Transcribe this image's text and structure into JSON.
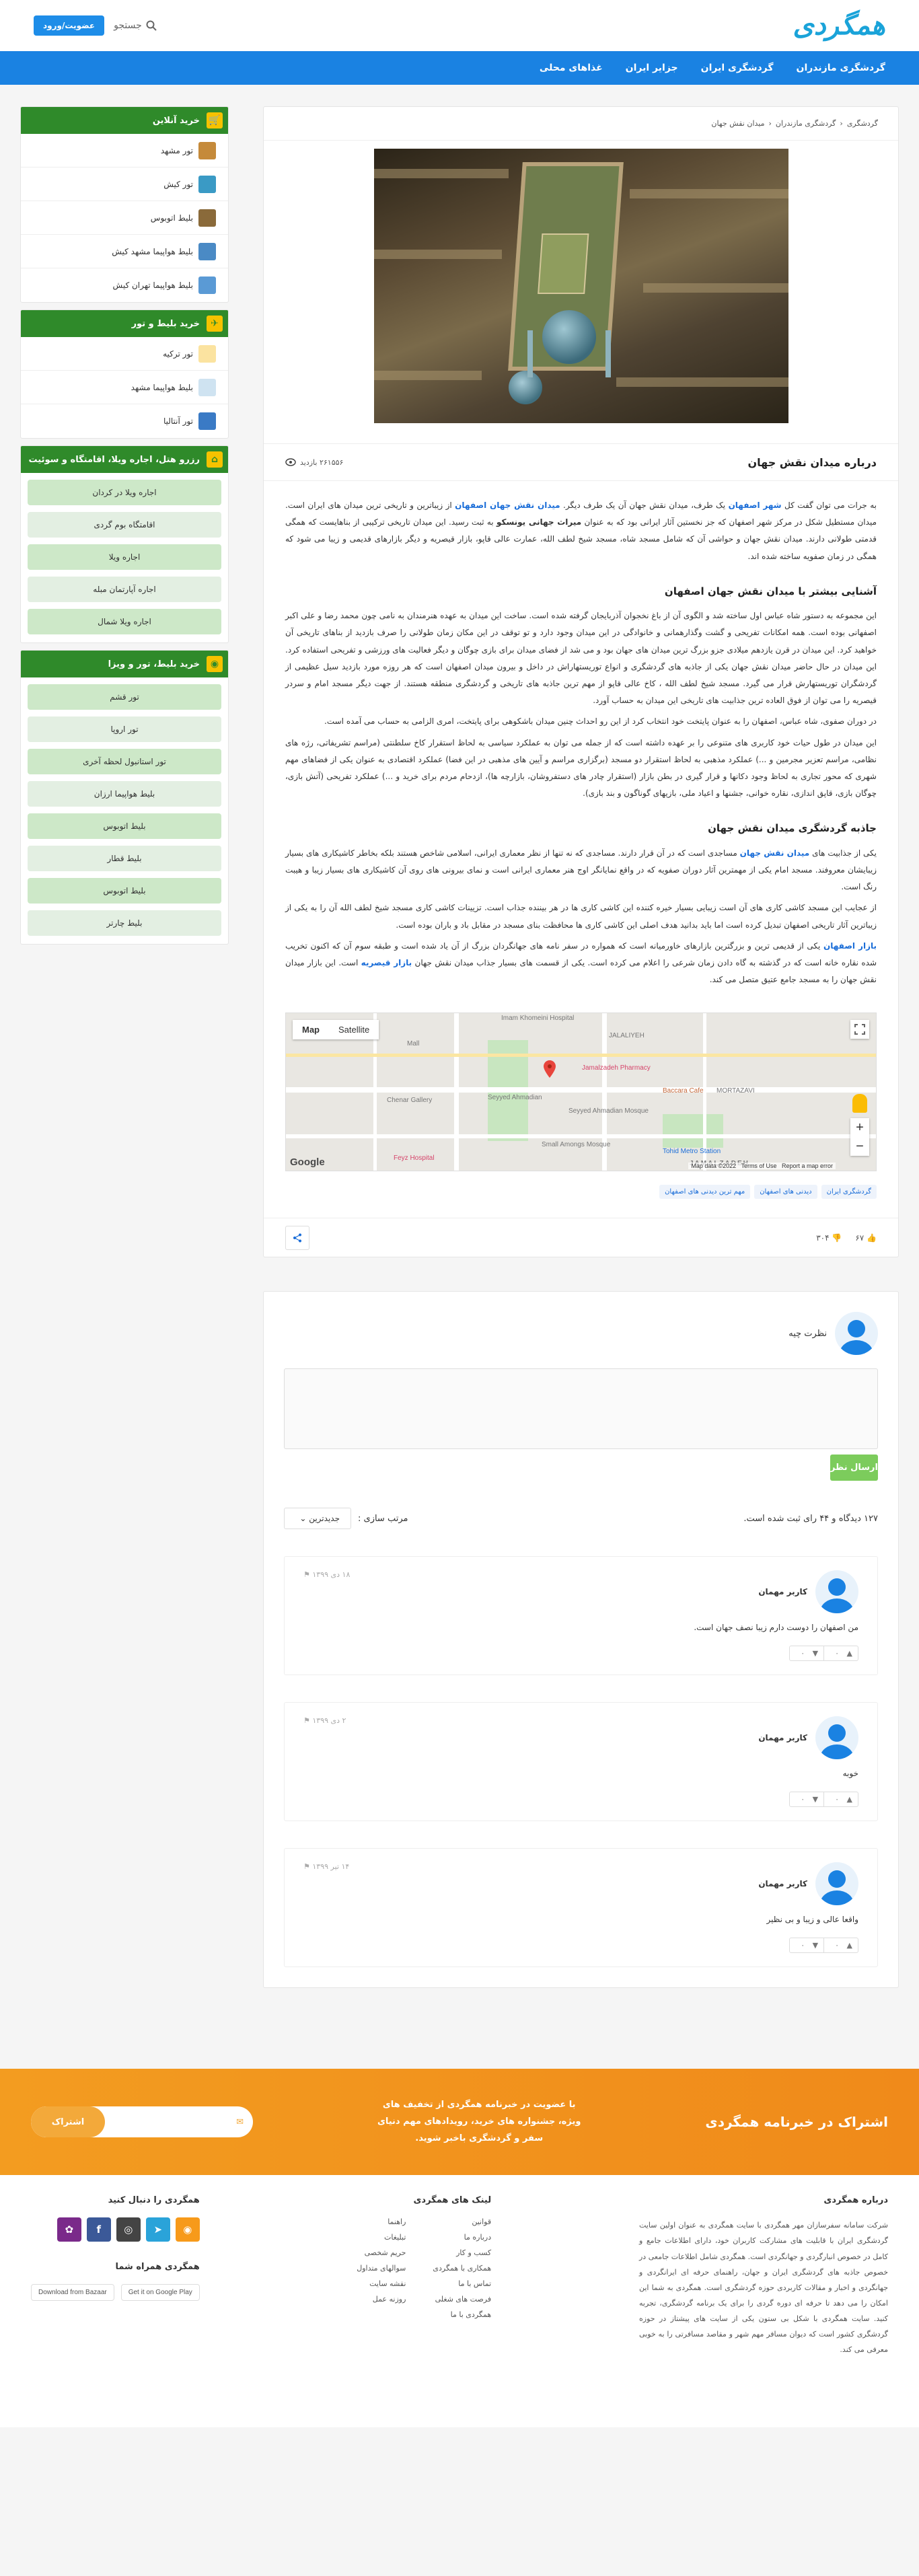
{
  "header": {
    "logo": "همگردی",
    "search_label": "جستجو",
    "login_label": "عضویت/ورود"
  },
  "nav": [
    "گردشگری مازندران",
    "گردشگری ایران",
    "جزایر ایران",
    "غذاهای محلی"
  ],
  "breadcrumb": [
    "گردشگری",
    "گردشگری مازندران",
    "میدان نقش جهان"
  ],
  "article": {
    "title": "درباره میدان نقش جهان",
    "views": "۲۶۱۵۵۶ بازدید",
    "p1_a": "به جرات می توان گفت کل ",
    "p1_link1": "شهر اصفهان",
    "p1_b": " یک طرف، میدان نقش جهان آن یک طرف دیگر. ",
    "p1_link2": "میدان نقش جهان اصفهان",
    "p1_c": " از زیباترین و تاریخی ترین میدان های ایران است. میدان مستطیل شکل در مرکز شهر اصفهان که جز نخستین آثار ایرانی بود که به عنوان ",
    "p1_bold": "میراث جهانی یونسکو",
    "p1_d": " به ثبت رسید. این میدان تاریخی ترکیبی از بناهایست که همگی قدمتی طولانی دارند. میدان نقش جهان و حواشی آن که شامل مسجد شاه، مسجد شیخ لطف الله، عمارت عالی قاپو، بازار قیصریه و دیگر بازارهای قدیمی و زیبا می شود که همگی در زمان صفویه ساخته شده اند.",
    "h2_1": "آشنایی بیشتر با میدان نقش جهان اصفهان",
    "p2": "این مجموعه به دستور شاه عباس اول ساخته شد و الگوی آن از باغ نخجوان آذربایجان گرفته شده است. ساخت این میدان به عهده هنرمندان به نامی چون محمد رضا و علی اکبر اصفهانی بوده است. همه امکانات تفریحی و گشت وگذارهمانی و خانوادگی در این میدان وجود دارد و تو توقف در این مکان زمان طولانی را صرف بازدید از بناهای تاریخی آن خواهید کرد. این میدان در قرن یازدهم میلادی جزو بزرگ ترین میدان های جهان بود و می شد از فضای میدان برای بازی چوگان و دیگر فعالیت های ورزشی و تفریحی استفاده کرد. این میدان در حال حاضر میدان نقش جهان یکی از جاذبه های گردشگری و انواع توریستهاراش در داخل و بیرون میدان اصفهان است که هر روزه مورد بازدید سیل عظیمی از گردشگران توریستهارش قرار می گیرد. مسجد شیخ لطف الله ، کاخ عالی قاپو از مهم ترین جاذبه های تاریخی و گردشگری منطقه هستند. از جهت دیگر مسجد امام و سردر قیصریه را می توان از فوق العاده ترین جذابیت های تاریخی این میدان به حساب آورد.",
    "p3": "در دوران صفوی، شاه عباس، اصفهان را به عنوان پایتخت خود انتخاب کرد از این رو احداث چنین میدان باشکوهی برای پایتخت، امری الزامی به حساب می آمده است.",
    "p4": "این میدان در طول حیات خود کاربری های متنوعی را بر عهده داشته است که از جمله می توان به عملکرد سیاسی به لحاظ استقرار کاخ سلطنتی (مراسم تشریفاتی، رژه های نظامی، مراسم تعزیر مجرمین و ...) عملکرد مذهبی به لحاظ استقرار دو مسجد (برگزاری مراسم و آیین های مذهبی در این فضا) عملکرد اقتصادی به عنوان یکی از فضاهای مهم شهری که محور تجاری به لحاظ وجود دکانها و قرار گیری در بطن بازار (استقرار چادر های دستفروشان، بازارچه ها)، ازدحام مردم برای خرید و ...) عملکرد تفریحی (آتش بازی، چوگان بازی، قاپق اندازی، نقاره خوانی، جشنها و اعیاد ملی، بازیهای گوناگون و بند بازی).",
    "h2_2": "جاذبه گردشگری میدان نقش جهان",
    "p5_a": "یکی از جذابیت های ",
    "p5_link": "میدان نقش جهان",
    "p5_b": " مساجدی است که در آن قرار دارند. مساجدی که نه تنها از نظر معماری ایرانی، اسلامی شاخص هستند بلکه بخاطر کاشیکاری های بسیار زیبایشان معروفند. مسجد امام یکی از مهمترین آثار دوران صفویه که در واقع نمایانگر اوج هنر معماری ایرانی است و نمای بیرونی های روی آن کاشیکاری های بسیار زیبا و هیبت رنگ است.",
    "p6": "از عجایب این مسجد کاشی کاری های آن است زیبایی بسیار خیره کننده این کاشی کاری ها در هر بیننده جذاب است. تزیینات کاشی کاری مسجد شیخ لطف الله آن را به یکی از زیباترین آثار تاریخی اصفهان تبدیل کرده است اما باید بدانید هدف اصلی این کاشی کاری ها محافظت بنای مسجد در مقابل باد و باران بوده است.",
    "p7_a": "بازار اصفهان",
    "p7_b": " یکی از قدیمی ترین و بزرگترین بازارهای خاورمیانه است که همواره در سفر نامه های جهانگردان بزرگ از آن یاد شده است و طبقه سوم آن که اکنون تخریب شده نقاره خانه است که در گذشته به گاه دادن زمان شرعی را اعلام می کرده است. یکی از قسمت های بسیار جذاب میدان نقش جهان ",
    "p7_c": "بازار قیصریه",
    "p7_d": " است. این بازار میدان نقش جهان را به مسجد جامع عتیق متصل می کند."
  },
  "map": {
    "tab_map": "Map",
    "tab_satellite": "Satellite",
    "labels": [
      "Imam Khomeini Hospital",
      "JALALIYEH",
      "Jamalzadeh Pharmacy",
      "Mall",
      "MORTAZAVI",
      "Chenar Gallery",
      "Seyyed Ahmadian",
      "Seyyed Ahmadian Mosque",
      "Baccara Cafe",
      "Small Amongs Mosque",
      "Tohid Metro Station",
      "Feyz Hospital",
      "JAMALZADEH",
      "Google",
      "Map data ©2022",
      "Terms of Use",
      "Report a map error"
    ]
  },
  "tags": [
    "گردشگری ایران",
    "دیدنی های اصفهان",
    "مهم ترین دیدنی های اصفهان"
  ],
  "rating": {
    "likes": "۶۷",
    "dislikes": "۳۰۴"
  },
  "comment_form": {
    "prompt": "نظرت چیه",
    "submit": "ارسال نظر",
    "stats": "۱۲۷ دیدگاه و ۴۴ رای ثبت شده است.",
    "sort_label": "مرتب سازی :",
    "sort_value": "جدیدترین"
  },
  "comments": [
    {
      "user": "کاربر مهمان",
      "date": "۱۸ دی ۱۳۹۹",
      "text": "من اصفهان را دوست دارم زیبا نصف جهان است.",
      "up": "۰",
      "down": "۰"
    },
    {
      "user": "کاربر مهمان",
      "date": "۲ دی ۱۳۹۹",
      "text": "خوبه",
      "up": "۰",
      "down": "۰"
    },
    {
      "user": "کاربر مهمان",
      "date": "۱۴ تیر ۱۳۹۹",
      "text": "واقعا عالی و زیبا و بی نظیر",
      "up": "۰",
      "down": "۰"
    }
  ],
  "sidebar": {
    "online_title": "خرید آنلاین",
    "online_items": [
      "تور مشهد",
      "تور کیش",
      "بلیط اتوبوس",
      "بلیط هواپیما مشهد کیش",
      "بلیط هواپیما تهران کیش"
    ],
    "ticket_title": "خرید بلیط و تور",
    "ticket_items": [
      "تور ترکیه",
      "بلیط هواپیما مشهد",
      "تور آنتالیا"
    ],
    "hotel_title": "رزرو هتل، اجاره ویلا، اقامتگاه و سوئیت",
    "hotel_items": [
      "اجاره ویلا در کردان",
      "اقامتگاه بوم گردی",
      "اجاره ویلا",
      "اجاره آپارتمان مبله",
      "اجاره ویلا شمال"
    ],
    "tour_title": "خرید بلیط، تور و ویزا",
    "tour_items": [
      "تور قشم",
      "تور اروپا",
      "تور استانبول لحظه آخری",
      "بلیط هواپیما ارزان",
      "بلیط اتوبوس",
      "بلیط قطار",
      "بلیط اتوبوس",
      "بلیط چارتر"
    ]
  },
  "newsletter": {
    "title": "اشتراک در خبرنامه همگردی",
    "text": "با عضویت در خبرنامه همگردی از تخفیف های ویژه، جشنواره های خرید، رویدادهای مهم دنیای سفر و گردشگری باخبر شوید.",
    "button": "اشتراک"
  },
  "footer": {
    "about_title": "درباره همگردی",
    "about_text": "شرکت سامانه سفرسازان مهر همگردی با سایت همگردی به عنوان اولین سایت گردشگری ایران با قابلیت های مشارکت کاربران خود، دارای اطلاعات جامع و کامل در خصوص انبارگردی و جهانگردی است. همگردی شامل اطلاعات جامعی در خصوص جاذبه های گردشگری ایران و جهان، راهنمای حرفه ای ایرانگردی و جهانگردی و اخبار و مقالات کاربردی حوزه گردشگری است. همگردی به شما این امکان را می دهد تا حرفه ای دوره گردی را برای یک برنامه گردشگری، تجربه کنید. سایت همگردی با شکل بی ستون یکی از سایت های پیشتاز در حوزه گردشگری کشور است که دیوان مسافر مهم شهر و مقاصد مسافرتی را به خوبی معرفی می کند.",
    "links_title": "لینک های همگردی",
    "links": [
      "قوانین",
      "راهنما",
      "درباره ما",
      "تبلیغات",
      "کسب و کار",
      "حریم شخصی",
      "همکاری با همگردی",
      "سوالهای متداول",
      "تماس با ما",
      "نقشه سایت",
      "فرصت های شغلی",
      "روزنه عمل",
      "همگردی با ما"
    ],
    "follow_title": "همگردی را دنبال کنید",
    "apps_title": "همگردی همراه شما",
    "app1": "Get it on Google Play",
    "app2": "Download from Bazaar"
  }
}
